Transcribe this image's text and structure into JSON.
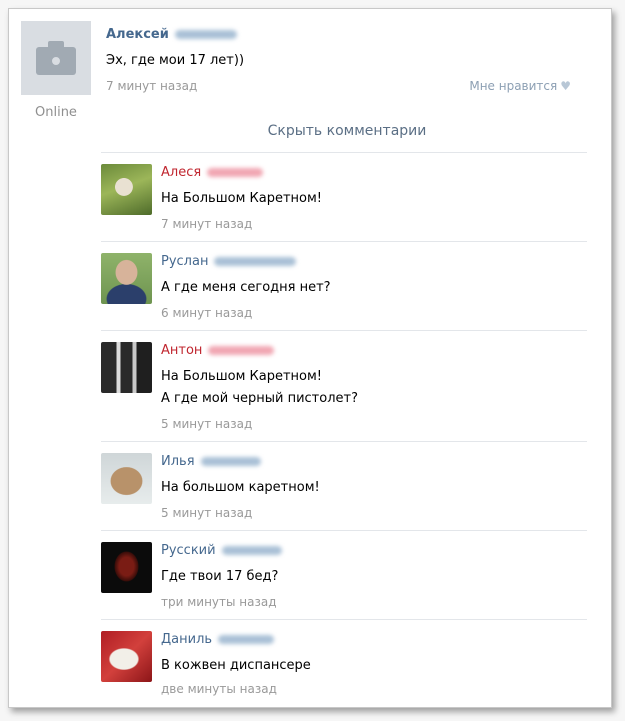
{
  "post": {
    "author": "Алексей",
    "text": "Эх, где мои 17 лет))",
    "time": "7 минут назад",
    "like_label": "Мне нравится",
    "online": "Online",
    "avatar_icon": "camera-icon"
  },
  "hide_comments": "Скрыть комментарии",
  "comments": [
    {
      "name": "Алеся",
      "lines": [
        "На Большом Каретном!"
      ],
      "time": "7 минут назад"
    },
    {
      "name": "Руслан",
      "lines": [
        "А где меня сегодня нет?"
      ],
      "time": "6 минут назад"
    },
    {
      "name": "Антон",
      "lines": [
        "На Большом Каретном!",
        "А где мой черный пистолет?"
      ],
      "time": "5 минут назад"
    },
    {
      "name": "Илья",
      "lines": [
        "На большом каретном!"
      ],
      "time": "5 минут назад"
    },
    {
      "name": "Русский",
      "lines": [
        "Где твои 17 бед?"
      ],
      "time": "три минуты назад"
    },
    {
      "name": "Даниль",
      "lines": [
        "В кожвен диспансере"
      ],
      "time": "две минуты назад"
    }
  ],
  "colors": {
    "link": "#45688e",
    "name_highlight": "#c0262f",
    "muted": "#999999"
  }
}
